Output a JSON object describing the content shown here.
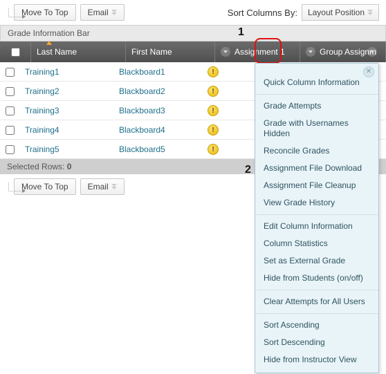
{
  "toolbar": {
    "move_to_top": "Move To Top",
    "email": "Email",
    "sort_label": "Sort Columns By:",
    "sort_value": "Layout Position"
  },
  "info_bar": "Grade Information Bar",
  "columns": {
    "last_name": "Last Name",
    "first_name": "First Name",
    "assignment1": "Assignment 1",
    "group_assign": "Group Assignm"
  },
  "rows": [
    {
      "last": "Training1",
      "first": "Blackboard1",
      "a1": "!",
      "grp": ""
    },
    {
      "last": "Training2",
      "first": "Blackboard2",
      "a1": "!",
      "grp": ""
    },
    {
      "last": "Training3",
      "first": "Blackboard3",
      "a1": "!",
      "grp": ""
    },
    {
      "last": "Training4",
      "first": "Blackboard4",
      "a1": "!",
      "grp": ""
    },
    {
      "last": "Training5",
      "first": "Blackboard5",
      "a1": "!",
      "grp": ""
    }
  ],
  "selected_rows_label": "Selected Rows:",
  "selected_rows_count": "0",
  "callouts": {
    "one": "1",
    "two": "2"
  },
  "menu": {
    "items": [
      "Quick Column Information",
      "---",
      "Grade Attempts",
      "Grade with Usernames Hidden",
      "Reconcile Grades",
      "Assignment File Download",
      "Assignment File Cleanup",
      "View Grade History",
      "---",
      "Edit Column Information",
      "Column Statistics",
      "Set as External Grade",
      "Hide from Students (on/off)",
      "---",
      "Clear Attempts for All Users",
      "---",
      "Sort Ascending",
      "Sort Descending",
      "Hide from Instructor View"
    ]
  }
}
